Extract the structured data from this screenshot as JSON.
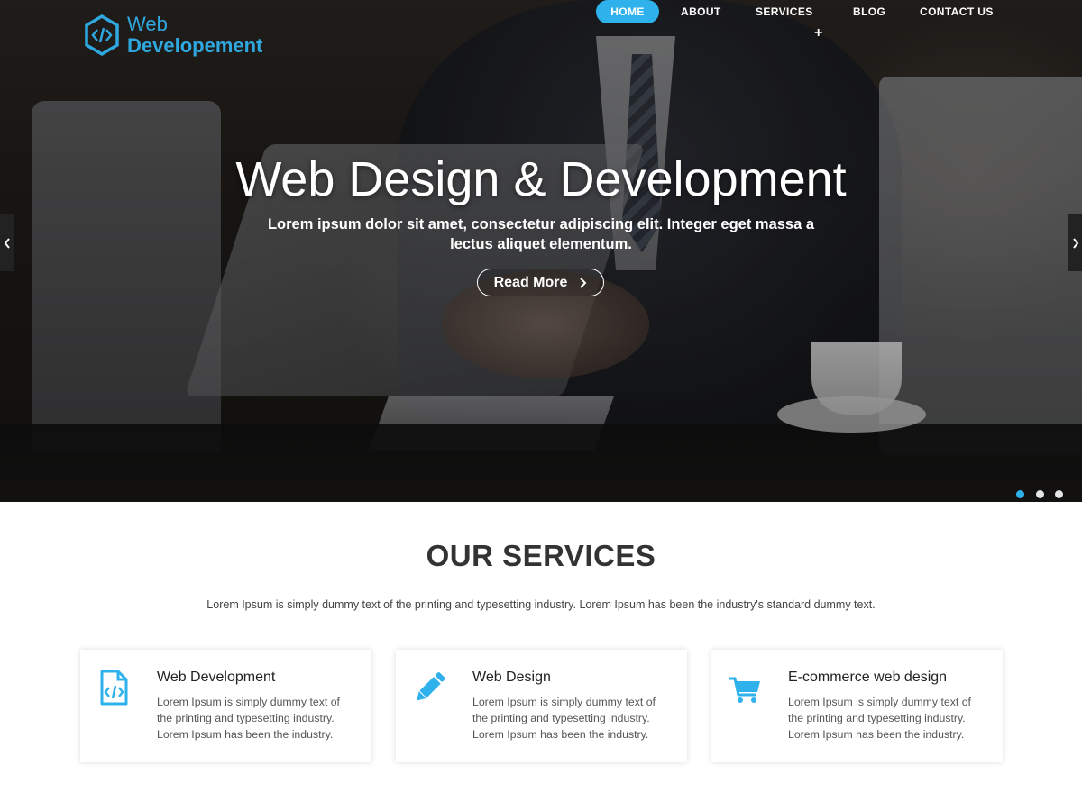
{
  "brand": {
    "line1": "Web",
    "line2": "Developement",
    "accent": "#2fa8e0",
    "icon": "code-hexagon-icon"
  },
  "nav": {
    "items": [
      {
        "label": "HOME",
        "active": true
      },
      {
        "label": "ABOUT",
        "active": false
      },
      {
        "label": "SERVICES",
        "active": false
      },
      {
        "label": "BLOG",
        "active": false
      },
      {
        "label": "CONTACT US",
        "active": false
      }
    ],
    "services_expand": "+",
    "active_color": "#2fb2ec"
  },
  "hero": {
    "title": "Web Design & Development",
    "subtitle": "Lorem ipsum dolor sit amet, consectetur adipiscing elit. Integer eget massa a lectus aliquet elementum.",
    "cta_label": "Read More",
    "cta_icon": "chevron-right-icon",
    "prev_icon": "chevron-left-icon",
    "next_icon": "chevron-right-icon",
    "slides": 3,
    "active_slide": 1
  },
  "services": {
    "title": "OUR SERVICES",
    "description": "Lorem Ipsum is simply dummy text of the printing and typesetting industry. Lorem Ipsum has been the industry's standard dummy text.",
    "cards": [
      {
        "icon": "code-file-icon",
        "title": "Web Development",
        "text": "Lorem Ipsum is simply dummy text of the printing and typesetting industry. Lorem Ipsum has been the industry."
      },
      {
        "icon": "pencil-icon",
        "title": "Web Design",
        "text": "Lorem Ipsum is simply dummy text of the printing and typesetting industry. Lorem Ipsum has been the industry."
      },
      {
        "icon": "shopping-cart-icon",
        "title": "E-commerce web design",
        "text": "Lorem Ipsum is simply dummy text of the printing and typesetting industry. Lorem Ipsum has been the industry."
      }
    ]
  }
}
